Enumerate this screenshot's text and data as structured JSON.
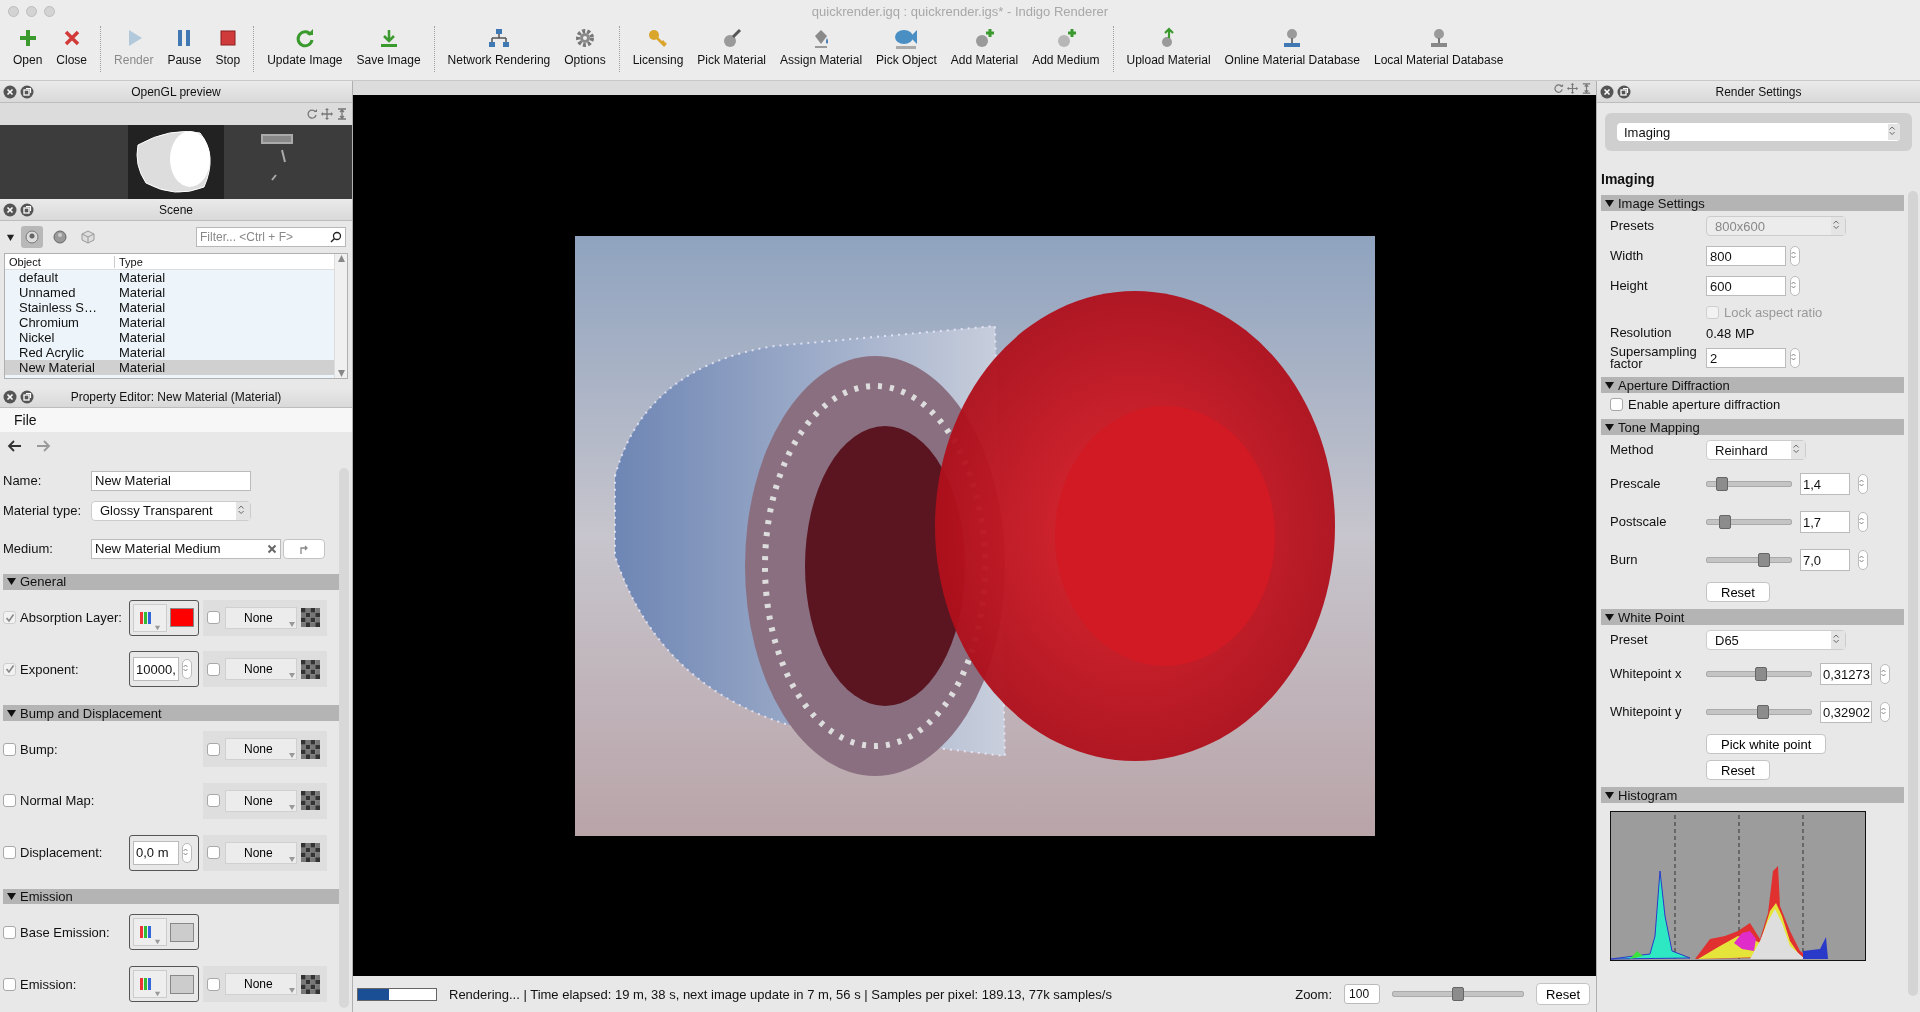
{
  "window": {
    "title": "quickrender.igq : quickrender.igs* - Indigo Renderer"
  },
  "toolbar": {
    "groups": [
      [
        {
          "label": "Open",
          "disabled": false
        },
        {
          "label": "Close",
          "disabled": false
        }
      ],
      [
        {
          "label": "Render",
          "disabled": true
        },
        {
          "label": "Pause",
          "disabled": false
        },
        {
          "label": "Stop",
          "disabled": false
        }
      ],
      [
        {
          "label": "Update Image",
          "disabled": false
        },
        {
          "label": "Save Image",
          "disabled": false
        }
      ],
      [
        {
          "label": "Network Rendering",
          "disabled": false
        },
        {
          "label": "Options",
          "disabled": false
        }
      ],
      [
        {
          "label": "Licensing",
          "disabled": false
        },
        {
          "label": "Pick Material",
          "disabled": false
        },
        {
          "label": "Assign Material",
          "disabled": false
        },
        {
          "label": "Pick Object",
          "disabled": false
        },
        {
          "label": "Add Material",
          "disabled": false
        },
        {
          "label": "Add Medium",
          "disabled": false
        }
      ],
      [
        {
          "label": "Upload Material",
          "disabled": false
        },
        {
          "label": "Online Material Database",
          "disabled": false
        },
        {
          "label": "Local Material Database",
          "disabled": false
        }
      ]
    ]
  },
  "opengl_preview": {
    "title": "OpenGL preview"
  },
  "scene": {
    "title": "Scene",
    "view_buttons": [
      {
        "selected": true
      },
      {
        "selected": false
      },
      {
        "selected": false
      }
    ],
    "filter": {
      "placeholder": "Filter... <Ctrl + F>"
    },
    "columns": [
      "Object",
      "Type"
    ],
    "rows": [
      {
        "object": "default",
        "type": "Material",
        "selected": false
      },
      {
        "object": "Unnamed",
        "type": "Material",
        "selected": false
      },
      {
        "object": "Stainless S…",
        "type": "Material",
        "selected": false
      },
      {
        "object": "Chromium",
        "type": "Material",
        "selected": false
      },
      {
        "object": "Nickel",
        "type": "Material",
        "selected": false
      },
      {
        "object": "Red Acrylic",
        "type": "Material",
        "selected": false
      },
      {
        "object": "New Material",
        "type": "Material",
        "selected": true
      }
    ]
  },
  "property_editor": {
    "title": "Property Editor: New Material (Material)",
    "menu": [
      "File"
    ],
    "name": {
      "label": "Name:",
      "value": "New Material"
    },
    "material_type": {
      "label": "Material type:",
      "value": "Glossy Transparent"
    },
    "medium": {
      "label": "Medium:",
      "value": "New Material Medium"
    },
    "sections": [
      {
        "title": "General",
        "expanded": true,
        "rows": [
          {
            "kind": "spectrum",
            "label": "Absorption Layer:",
            "checked": true,
            "color": "#ff0000",
            "texture": {
              "checked": false,
              "value": "None"
            }
          },
          {
            "kind": "number",
            "label": "Exponent:",
            "checked": true,
            "value": "10000,",
            "texture": {
              "checked": false,
              "value": "None"
            }
          }
        ]
      },
      {
        "title": "Bump and Displacement",
        "expanded": true,
        "rows": [
          {
            "kind": "texture",
            "label": "Bump:",
            "checked": false,
            "texture": {
              "checked": false,
              "value": "None"
            }
          },
          {
            "kind": "texture",
            "label": "Normal Map:",
            "checked": false,
            "texture": {
              "checked": false,
              "value": "None"
            }
          },
          {
            "kind": "number",
            "label": "Displacement:",
            "checked": false,
            "value": "0,0 m",
            "texture": {
              "checked": false,
              "value": "None"
            }
          }
        ]
      },
      {
        "title": "Emission",
        "expanded": true,
        "rows": [
          {
            "kind": "spectrum",
            "label": "Base Emission:",
            "checked": false,
            "color": "#cccccc"
          },
          {
            "kind": "spectrum",
            "label": "Emission:",
            "checked": false,
            "color": "#cccccc",
            "texture": {
              "checked": false,
              "value": "None"
            }
          }
        ]
      }
    ]
  },
  "render_settings": {
    "title": "Render Settings",
    "category": "Imaging",
    "heading": "Imaging",
    "sections": [
      {
        "title": "Image Settings",
        "expanded": true,
        "rows": [
          {
            "kind": "select",
            "label": "Presets",
            "value": "800x600",
            "disabled": true
          },
          {
            "kind": "spin",
            "label": "Width",
            "value": "800"
          },
          {
            "kind": "spin",
            "label": "Height",
            "value": "600"
          },
          {
            "kind": "checkbox",
            "label": "Lock aspect ratio",
            "checked": false,
            "disabled": true
          },
          {
            "kind": "text",
            "label": "Resolution",
            "value": "0.48 MP"
          },
          {
            "kind": "spin",
            "label": "Supersampling factor",
            "value": "2"
          }
        ]
      },
      {
        "title": "Aperture Diffraction",
        "expanded": true,
        "rows": [
          {
            "kind": "checkbox",
            "label": "Enable aperture diffraction",
            "checked": false,
            "disabled": false
          }
        ]
      },
      {
        "title": "Tone Mapping",
        "expanded": true,
        "rows": [
          {
            "kind": "select",
            "label": "Method",
            "value": "Reinhard",
            "disabled": false
          },
          {
            "kind": "slider",
            "label": "Prescale",
            "level": 0.18,
            "value": "1,4"
          },
          {
            "kind": "slider",
            "label": "Postscale",
            "level": 0.22,
            "value": "1,7"
          },
          {
            "kind": "slider",
            "label": "Burn",
            "level": 0.68,
            "value": "7,0"
          },
          {
            "kind": "button",
            "label": "Reset"
          }
        ]
      },
      {
        "title": "White Point",
        "expanded": true,
        "rows": [
          {
            "kind": "select",
            "label": "Preset",
            "value": "D65",
            "disabled": false
          },
          {
            "kind": "slider",
            "label": "Whitepoint x",
            "level": 0.52,
            "value": "0,31273"
          },
          {
            "kind": "slider",
            "label": "Whitepoint y",
            "level": 0.54,
            "value": "0,32902"
          },
          {
            "kind": "button",
            "label": "Pick white point"
          },
          {
            "kind": "button",
            "label": "Reset"
          }
        ]
      },
      {
        "title": "Histogram",
        "expanded": true,
        "rows": [
          {
            "kind": "histogram"
          }
        ]
      }
    ]
  },
  "status_bar": {
    "progress": {
      "level": 0.4
    },
    "message": "Rendering... | Time elapsed: 19 m, 38 s, next image update in 7 m, 56 s | Samples per pixel: 189.13, 77k samples/s",
    "zoom_label": "Zoom:",
    "zoom_value": "100",
    "zoom_slider": {
      "level": 0.5
    },
    "reset": "Reset"
  }
}
